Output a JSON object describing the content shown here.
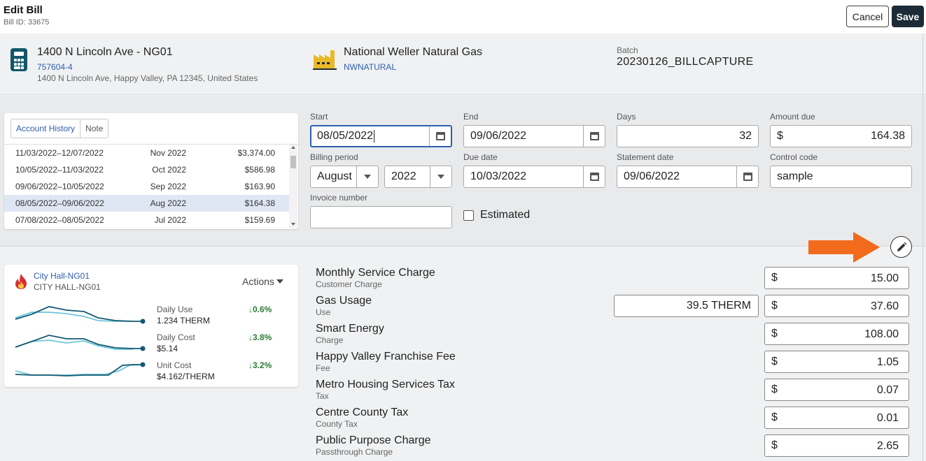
{
  "header": {
    "title": "Edit Bill",
    "bill_id": "Bill ID: 33675",
    "cancel_label": "Cancel",
    "save_label": "Save"
  },
  "location": {
    "name": "1400 N Lincoln Ave - NG01",
    "account": "757604-4",
    "address": "1400 N Lincoln Ave, Happy Valley, PA 12345, United States"
  },
  "vendor": {
    "name": "National Weller Natural Gas",
    "code": "NWNATURAL"
  },
  "batch": {
    "label": "Batch",
    "value": "20230126_BILLCAPTURE"
  },
  "history": {
    "tabs": [
      "Account History",
      "Note"
    ],
    "rows": [
      {
        "range": "11/03/2022–12/07/2022",
        "period": "Nov 2022",
        "amount": "$3,374.00"
      },
      {
        "range": "10/05/2022–11/03/2022",
        "period": "Oct 2022",
        "amount": "$586.98"
      },
      {
        "range": "09/06/2022–10/05/2022",
        "period": "Sep 2022",
        "amount": "$163.90"
      },
      {
        "range": "08/05/2022–09/06/2022",
        "period": "Aug 2022",
        "amount": "$164.38"
      },
      {
        "range": "07/08/2022–08/05/2022",
        "period": "Jul 2022",
        "amount": "$159.69"
      }
    ]
  },
  "form": {
    "start": {
      "label": "Start",
      "value": "08/05/2022"
    },
    "end": {
      "label": "End",
      "value": "09/06/2022"
    },
    "days": {
      "label": "Days",
      "value": "32"
    },
    "amount_due": {
      "label": "Amount due",
      "currency": "$",
      "value": "164.38"
    },
    "billing_period": {
      "label": "Billing period",
      "month": "August",
      "year": "2022"
    },
    "due_date": {
      "label": "Due date",
      "value": "10/03/2022"
    },
    "statement_date": {
      "label": "Statement date",
      "value": "09/06/2022"
    },
    "control_code": {
      "label": "Control code",
      "value": "sample"
    },
    "invoice_number": {
      "label": "Invoice number",
      "value": ""
    },
    "estimated": {
      "label": "Estimated",
      "checked": false
    }
  },
  "meter": {
    "name": "City Hall-NG01",
    "subname": "CITY HALL-NG01",
    "actions_label": "Actions",
    "metrics": [
      {
        "label": "Daily Use",
        "value": "1.234 THERM",
        "change": "↓0.6%"
      },
      {
        "label": "Daily Cost",
        "value": "$5.14",
        "change": "↓3.8%"
      },
      {
        "label": "Unit Cost",
        "value": "$4.162/THERM",
        "change": "↓3.2%"
      }
    ]
  },
  "charges": [
    {
      "name": "Monthly Service Charge",
      "type": "Customer Charge",
      "usage": "",
      "currency": "$",
      "amount": "15.00"
    },
    {
      "name": "Gas Usage",
      "type": "Use",
      "usage": "39.5 THERM",
      "currency": "$",
      "amount": "37.60"
    },
    {
      "name": "Smart Energy",
      "type": "Charge",
      "usage": "",
      "currency": "$",
      "amount": "108.00"
    },
    {
      "name": "Happy Valley Franchise Fee",
      "type": "Fee",
      "usage": "",
      "currency": "$",
      "amount": "1.05"
    },
    {
      "name": "Metro Housing Services Tax",
      "type": "Tax",
      "usage": "",
      "currency": "$",
      "amount": "0.07"
    },
    {
      "name": "Centre County Tax",
      "type": "County Tax",
      "usage": "",
      "currency": "$",
      "amount": "0.01"
    },
    {
      "name": "Public Purpose Charge",
      "type": "Passthrough Charge",
      "usage": "",
      "currency": "$",
      "amount": "2.65"
    }
  ],
  "colors": {
    "accent": "#2f5eb1",
    "save_bg": "#1c2b36",
    "arrow": "#f26b1d",
    "spark_dark": "#145a72",
    "spark_light": "#6cc6da",
    "positive": "#2e7d32"
  }
}
